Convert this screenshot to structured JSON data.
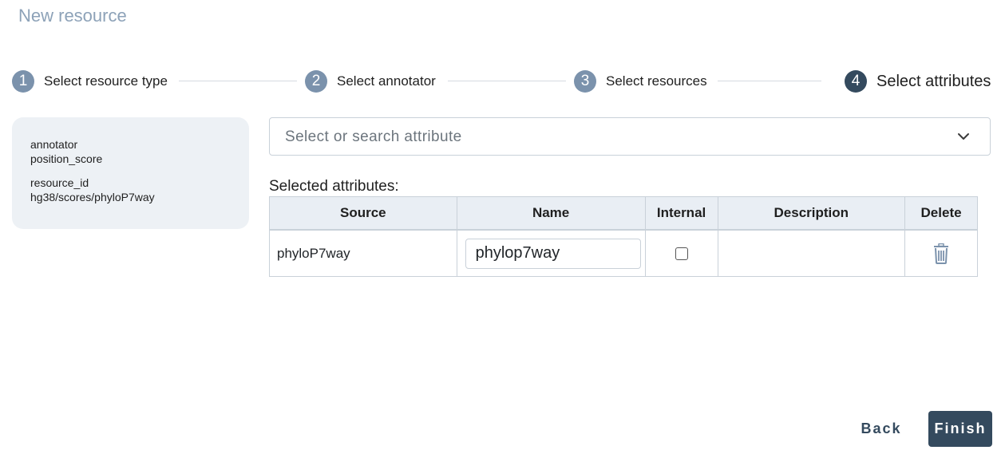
{
  "page": {
    "title": "New resource"
  },
  "stepper": {
    "steps": [
      {
        "number": "1",
        "label": "Select resource type",
        "state": "done"
      },
      {
        "number": "2",
        "label": "Select annotator",
        "state": "done"
      },
      {
        "number": "3",
        "label": "Select resources",
        "state": "done"
      },
      {
        "number": "4",
        "label": "Select attributes",
        "state": "active"
      }
    ]
  },
  "summary": {
    "annotator_key": "annotator",
    "annotator_value": "position_score",
    "resource_key": "resource_id",
    "resource_value": "hg38/scores/phyloP7way"
  },
  "attribute_search": {
    "placeholder": "Select or search attribute",
    "icon": "chevron-down-icon"
  },
  "selected": {
    "label": "Selected attributes:",
    "columns": [
      "Source",
      "Name",
      "Internal",
      "Description",
      "Delete"
    ],
    "rows": [
      {
        "source": "phyloP7way",
        "name": "phylop7way",
        "internal": false,
        "description": "",
        "delete_icon": "trash-icon"
      }
    ]
  },
  "actions": {
    "back_label": "Back",
    "finish_label": "Finish"
  },
  "colors": {
    "accent": "#344a5e",
    "step_inactive": "#7b92ac",
    "title": "#8da2b8",
    "card_bg": "#edf1f5",
    "table_header_bg": "#e9eef4"
  }
}
